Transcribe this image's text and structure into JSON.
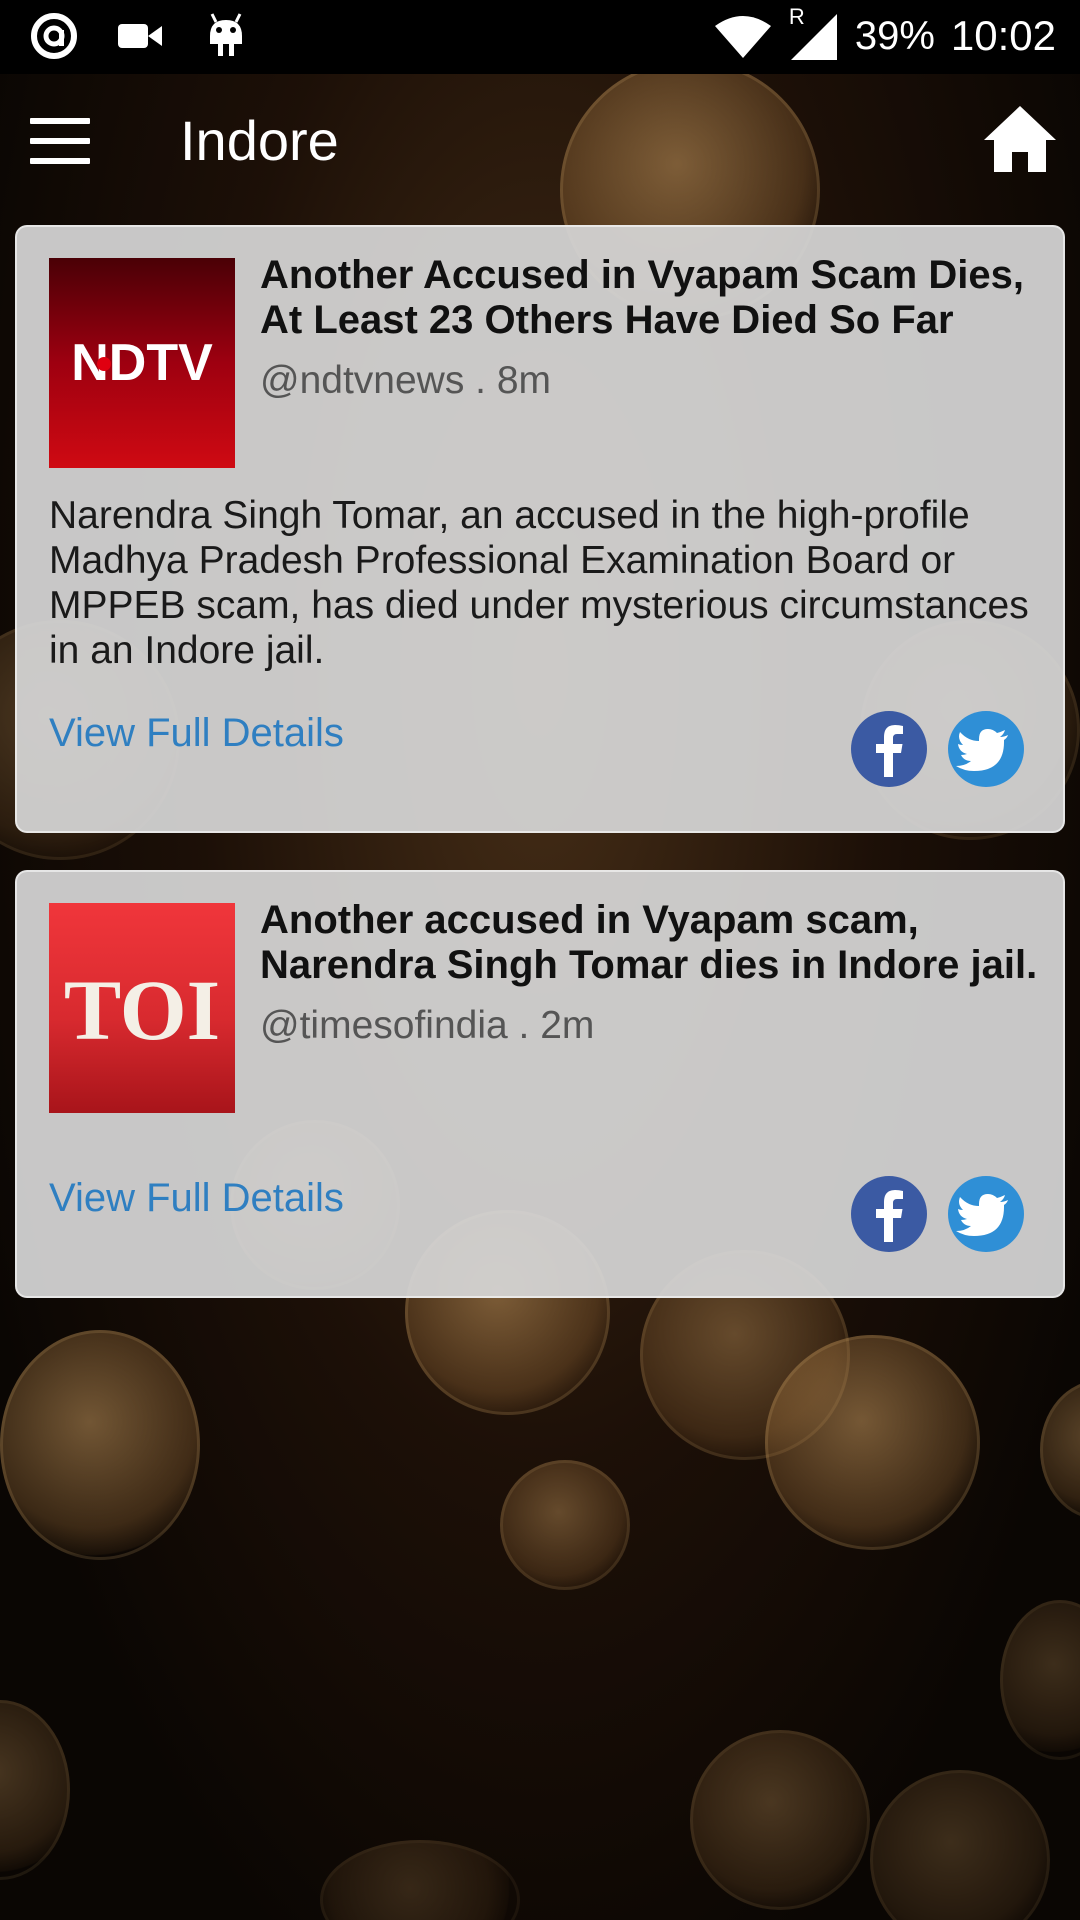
{
  "status_bar": {
    "battery": "39%",
    "time": "10:02",
    "network_indicator": "R",
    "icons": [
      "notification-a-icon",
      "video-camera-icon",
      "android-icon",
      "wifi-icon",
      "signal-icon"
    ]
  },
  "app_bar": {
    "title": "Indore",
    "menu_icon": "hamburger-menu-icon",
    "home_icon": "home-icon"
  },
  "articles": [
    {
      "logo_text": "NDTV",
      "headline": "Another Accused in Vyapam Scam Dies, At Least 23 Others Have Died So Far",
      "byline": "@ndtvnews . 8m",
      "summary": "Narendra Singh Tomar, an accused in the high-profile Madhya Pradesh Professional Examination Board or MPPEB scam, has died under mysterious circumstances in an Indore jail.",
      "link_label": "View Full Details"
    },
    {
      "logo_text": "TOI",
      "headline": "Another accused in Vyapam scam, Narendra Singh Tomar dies in Indore jail.",
      "byline": "@timesofindia . 2m",
      "summary": "",
      "link_label": "View Full Details"
    }
  ],
  "colors": {
    "link": "#2f7fc1",
    "facebook": "#3b5aa3",
    "twitter": "#2f8fd6",
    "ndtv_red": "#c8000a",
    "toi_red": "#d42a2f"
  }
}
